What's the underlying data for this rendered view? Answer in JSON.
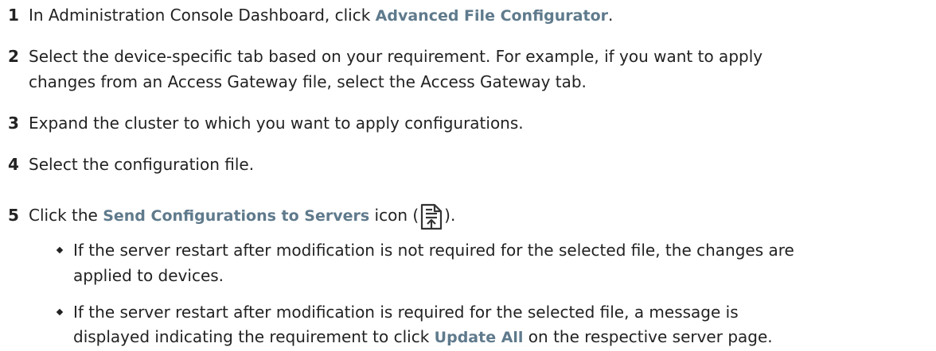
{
  "steps": [
    {
      "num": "1",
      "before": "In Administration Console Dashboard, click ",
      "ui": "Advanced File Configurator",
      "after": "."
    },
    {
      "num": "2",
      "line1": "Select the device-specific tab based on your requirement. For example, if you want to apply",
      "line2": "changes from an Access Gateway file, select the Access Gateway tab."
    },
    {
      "num": "3",
      "text": "Expand the cluster to which you want to apply configurations."
    },
    {
      "num": "4",
      "text": "Select the configuration file."
    },
    {
      "num": "5",
      "before": "Click the ",
      "ui": "Send Configurations to Servers",
      "middle": " icon (",
      "after": ").",
      "icon": "send-configurations-icon"
    }
  ],
  "bullets": [
    {
      "line1": "If the server restart after modification is not required for the selected file, the changes are",
      "line2": "applied to devices."
    },
    {
      "line1": "If the server restart after modification is required for the selected file, a message is",
      "line2_before": "displayed indicating the requirement to click ",
      "line2_ui": "Update All",
      "line2_after": " on the respective server page."
    }
  ],
  "colors": {
    "ui_term": "#5f7a8c",
    "body_text": "#222222"
  }
}
